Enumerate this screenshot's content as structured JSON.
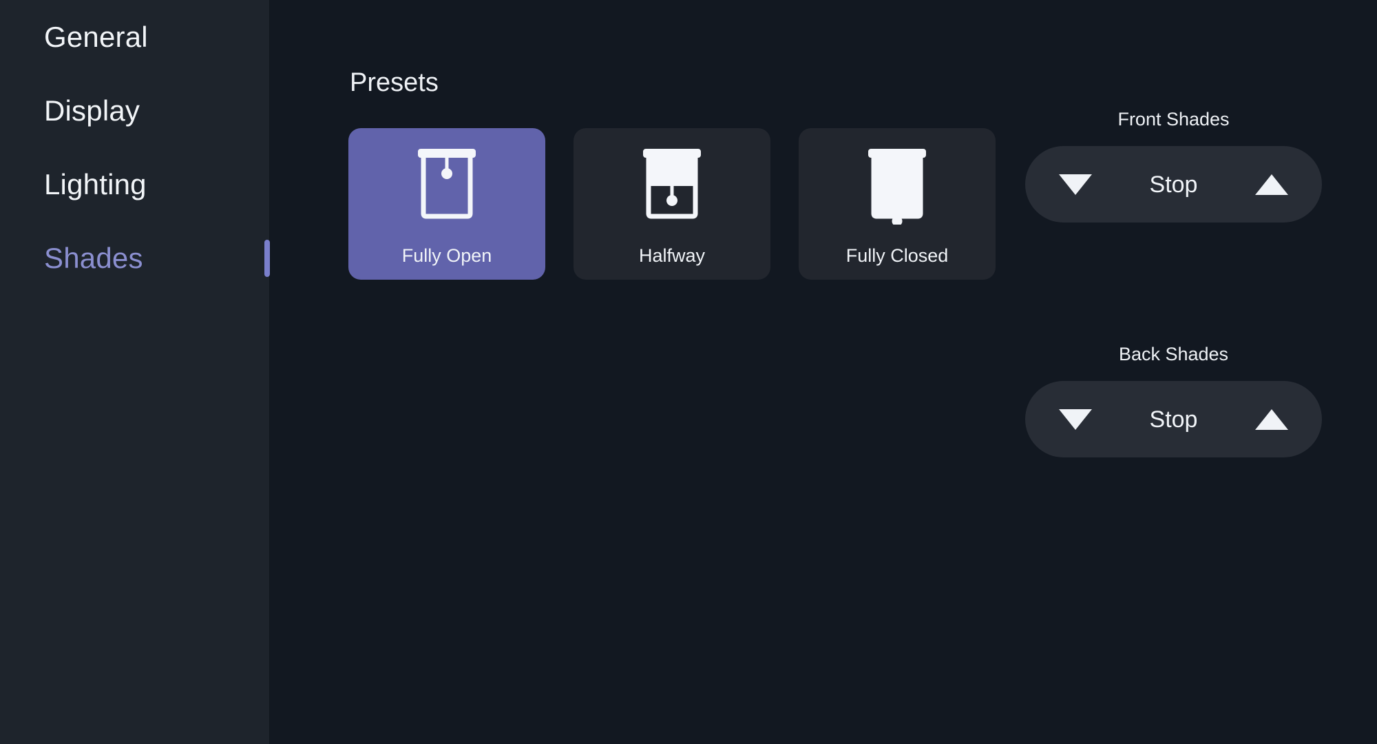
{
  "theme": {
    "sidebar_bg": "#1e242c",
    "main_bg": "#121821",
    "card_bg": "#22262e",
    "accent": "#6163ab",
    "accent_text": "#8b8fd0",
    "pill_bg": "#282d36",
    "text": "#f1f4f8"
  },
  "sidebar": {
    "items": [
      {
        "label": "General",
        "active": false
      },
      {
        "label": "Display",
        "active": false
      },
      {
        "label": "Lighting",
        "active": false
      },
      {
        "label": "Shades",
        "active": true
      }
    ]
  },
  "main": {
    "section_title": "Presets",
    "presets": [
      {
        "label": "Fully Open",
        "icon": "shade-fully-open-icon",
        "shade_fill": 0.0,
        "selected": true
      },
      {
        "label": "Halfway",
        "icon": "shade-halfway-icon",
        "shade_fill": 0.5,
        "selected": false
      },
      {
        "label": "Fully Closed",
        "icon": "shade-fully-closed-icon",
        "shade_fill": 1.0,
        "selected": false
      }
    ],
    "shade_groups": [
      {
        "title": "Front Shades",
        "down_icon": "triangle-down-icon",
        "status": "Stop",
        "up_icon": "triangle-up-icon"
      },
      {
        "title": "Back Shades",
        "down_icon": "triangle-down-icon",
        "status": "Stop",
        "up_icon": "triangle-up-icon"
      }
    ]
  }
}
